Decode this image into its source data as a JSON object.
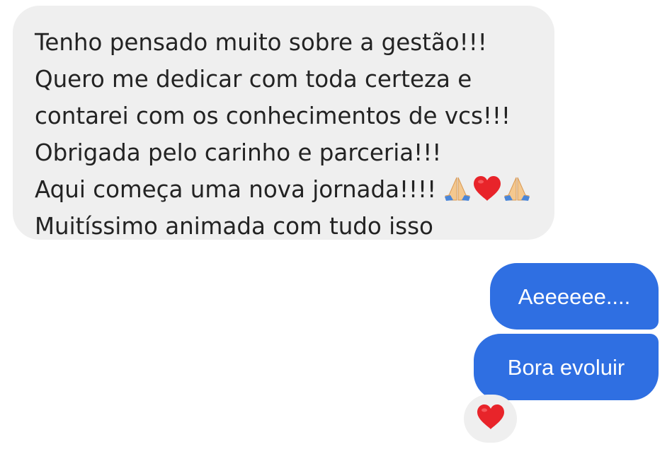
{
  "conversation": {
    "incoming_message": {
      "lines": [
        "Tenho pensado muito sobre a gestão!!!",
        "Quero me dedicar com toda certeza e",
        "contarei com os conhecimentos de vcs!!!",
        "Obrigada pelo carinho e parceria!!!",
        "Aqui começa uma nova jornada!!!!",
        "Muitíssimo animada com tudo isso"
      ],
      "line5_emojis": [
        "folded-hands-icon",
        "red-heart-icon",
        "folded-hands-icon"
      ]
    },
    "outgoing_messages": [
      {
        "text": "Aeeeeee...."
      },
      {
        "text": "Bora evoluir"
      }
    ],
    "reaction": {
      "icon": "red-heart-icon"
    }
  },
  "colors": {
    "incoming_bubble": "#efefef",
    "incoming_text": "#232323",
    "outgoing_bubble": "#2f6fe2",
    "outgoing_text": "#ffffff",
    "heart": "#e8242a"
  }
}
